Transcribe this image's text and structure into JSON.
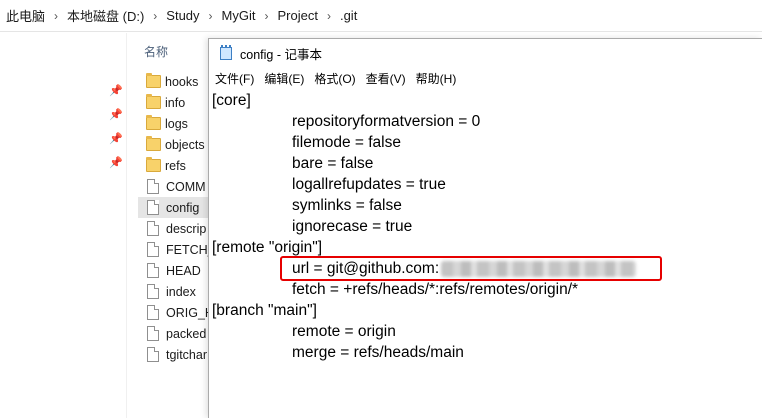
{
  "breadcrumb": [
    "此电脑",
    "本地磁盘 (D:)",
    "Study",
    "MyGit",
    "Project",
    ".git"
  ],
  "explorer": {
    "column_name": "名称",
    "files": [
      {
        "name": "hooks",
        "type": "folder"
      },
      {
        "name": "info",
        "type": "folder"
      },
      {
        "name": "logs",
        "type": "folder"
      },
      {
        "name": "objects",
        "type": "folder"
      },
      {
        "name": "refs",
        "type": "folder"
      },
      {
        "name": "COMM",
        "type": "file"
      },
      {
        "name": "config",
        "type": "file",
        "selected": true
      },
      {
        "name": "descrip",
        "type": "file"
      },
      {
        "name": "FETCH_",
        "type": "file"
      },
      {
        "name": "HEAD",
        "type": "file"
      },
      {
        "name": "index",
        "type": "file"
      },
      {
        "name": "ORIG_H",
        "type": "file"
      },
      {
        "name": "packed",
        "type": "file"
      },
      {
        "name": "tgitchar",
        "type": "file"
      }
    ],
    "pin_icon": "pin-icon"
  },
  "notepad": {
    "title": "config - 记事本",
    "menu": [
      "文件(F)",
      "编辑(E)",
      "格式(O)",
      "查看(V)",
      "帮助(H)"
    ],
    "lines": [
      {
        "text": "[core]",
        "indent": false
      },
      {
        "text": "repositoryformatversion = 0",
        "indent": true
      },
      {
        "text": "filemode = false",
        "indent": true
      },
      {
        "text": "bare = false",
        "indent": true
      },
      {
        "text": "logallrefupdates = true",
        "indent": true
      },
      {
        "text": "symlinks = false",
        "indent": true
      },
      {
        "text": "ignorecase = true",
        "indent": true
      },
      {
        "text": "[remote \"origin\"]",
        "indent": false
      },
      {
        "text": "url = git@github.com:",
        "indent": true,
        "redacted": true
      },
      {
        "text": "fetch = +refs/heads/*:refs/remotes/origin/*",
        "indent": true
      },
      {
        "text": "[branch \"main\"]",
        "indent": false
      },
      {
        "text": "remote = origin",
        "indent": true
      },
      {
        "text": "merge = refs/heads/main",
        "indent": true
      }
    ],
    "highlight_color": "#e60000"
  }
}
